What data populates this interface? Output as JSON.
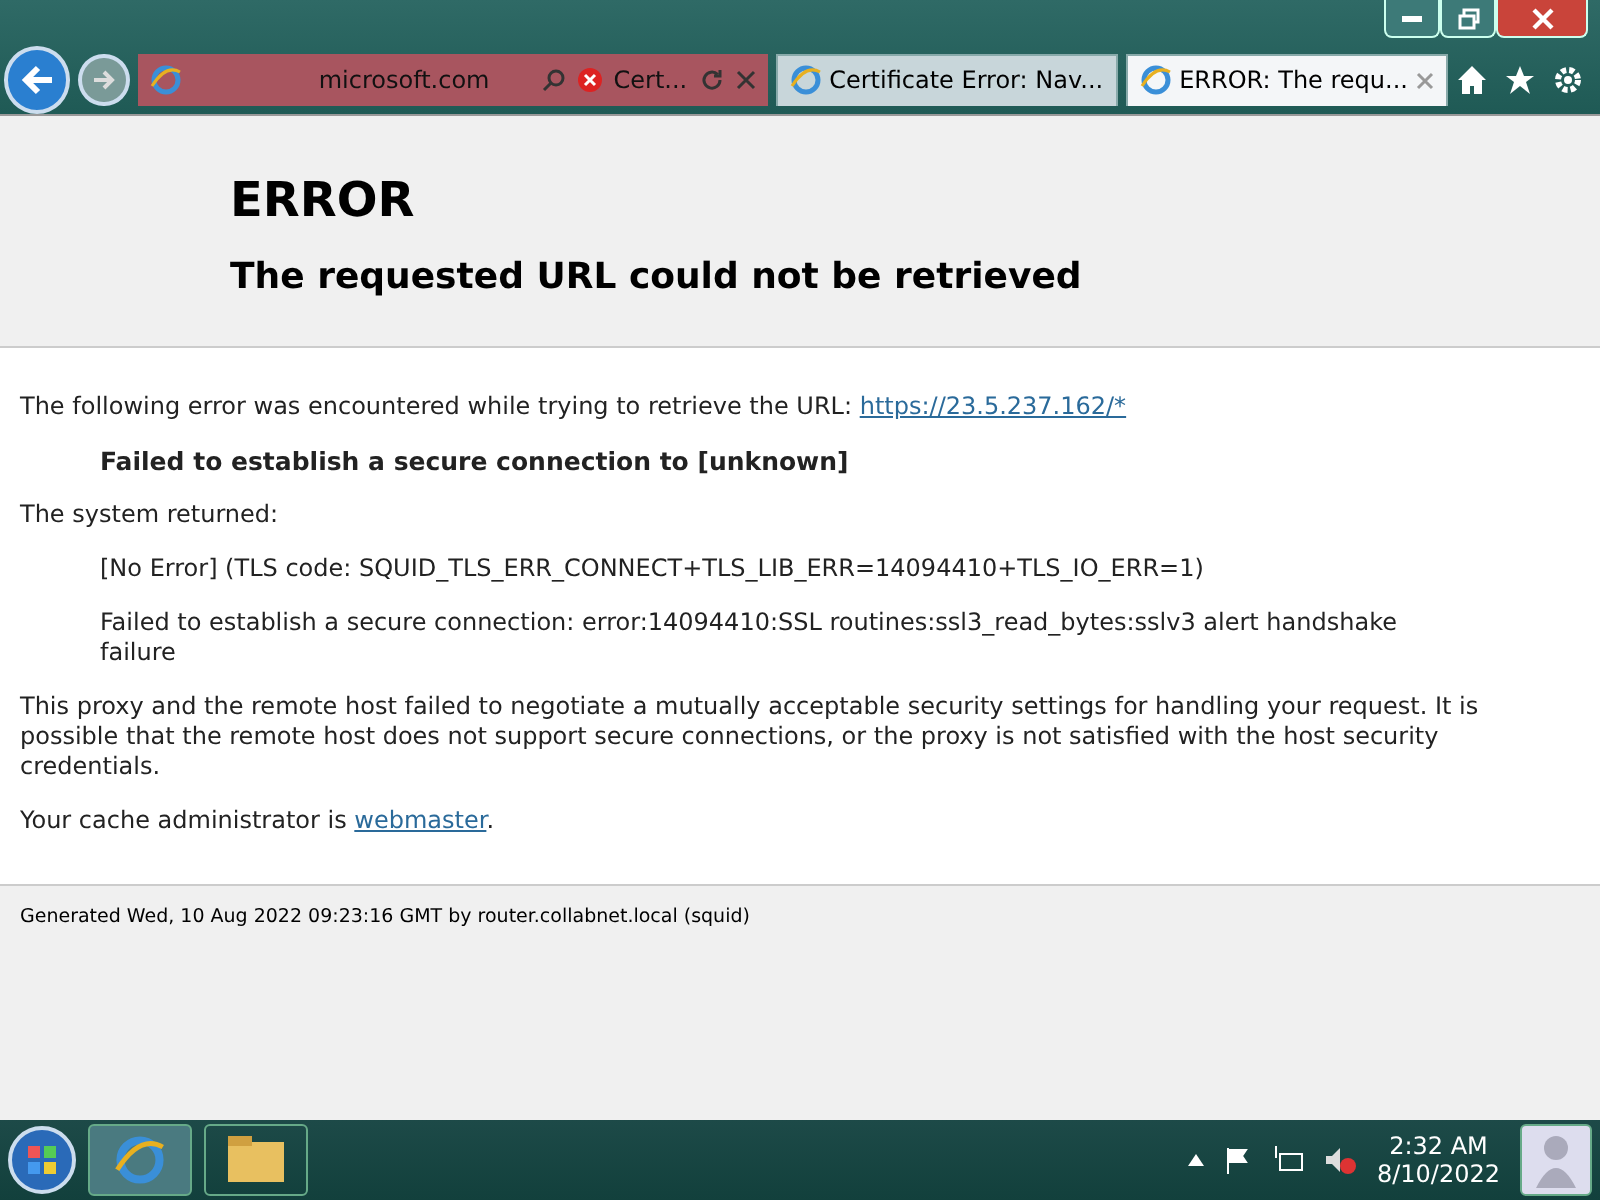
{
  "address_bar": {
    "url": "microsoft.com",
    "certificate_label": "Cert..."
  },
  "tabs": [
    {
      "title": "Certificate Error: Nav...",
      "selected": false
    },
    {
      "title": "ERROR: The requ...",
      "selected": true
    }
  ],
  "page": {
    "heading": "ERROR",
    "subheading": "The requested URL could not be retrieved",
    "intro": {
      "text": "The following error was encountered while trying to retrieve the URL: ",
      "link": "https://23.5.237.162/*"
    },
    "error_title": "Failed to establish a secure connection to [unknown]",
    "system_label": "The system returned:",
    "system_lines": [
      "[No Error] (TLS code: SQUID_TLS_ERR_CONNECT+TLS_LIB_ERR=14094410+TLS_IO_ERR=1)",
      "Failed to establish a secure connection: error:14094410:SSL routines:ssl3_read_bytes:sslv3 alert handshake failure"
    ],
    "explanation": "This proxy and the remote host failed to negotiate a mutually acceptable security settings for handling your request. It is possible that the remote host does not support secure connections, or the proxy is not satisfied with the host security credentials.",
    "admin": {
      "text": "Your cache administrator is ",
      "link": "webmaster",
      "suffix": "."
    },
    "footer": "Generated Wed, 10 Aug 2022 09:23:16 GMT by router.collabnet.local (squid)"
  },
  "taskbar": {
    "time": "2:32 AM",
    "date": "8/10/2022"
  }
}
